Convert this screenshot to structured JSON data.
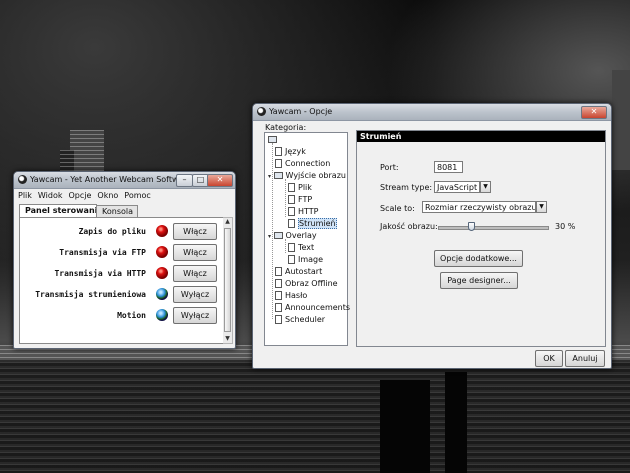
{
  "small_window": {
    "title": "Yawcam - Yet Another Webcam Software",
    "menu": [
      "Plik",
      "Widok",
      "Opcje",
      "Okno",
      "Pomoc"
    ],
    "tabs": [
      "Panel sterowania",
      "Konsola"
    ],
    "active_tab": "Panel sterowania",
    "rows": [
      {
        "label": "Zapis do pliku",
        "indicator": "red",
        "button": "Włącz"
      },
      {
        "label": "Transmisja via FTP",
        "indicator": "red",
        "button": "Włącz"
      },
      {
        "label": "Transmisja via HTTP",
        "indicator": "red",
        "button": "Włącz"
      },
      {
        "label": "Transmisja strumieniowa",
        "indicator": "globe",
        "button": "Wyłącz"
      },
      {
        "label": "Motion",
        "indicator": "globe",
        "button": "Wyłącz"
      }
    ]
  },
  "options_window": {
    "title": "Yawcam - Opcje",
    "category_label": "Kategoria:",
    "tree": [
      {
        "label": "Język",
        "type": "file"
      },
      {
        "label": "Connection",
        "type": "file"
      },
      {
        "label": "Wyjście obrazu",
        "type": "folder",
        "expanded": true
      },
      {
        "label": "Plik",
        "type": "file"
      },
      {
        "label": "FTP",
        "type": "file"
      },
      {
        "label": "HTTP",
        "type": "file"
      },
      {
        "label": "Strumień",
        "type": "file",
        "selected": true
      },
      {
        "label": "Overlay",
        "type": "folder",
        "expanded": true
      },
      {
        "label": "Text",
        "type": "file"
      },
      {
        "label": "Image",
        "type": "file"
      },
      {
        "label": "Autostart",
        "type": "file"
      },
      {
        "label": "Obraz Offline",
        "type": "file"
      },
      {
        "label": "Hasło",
        "type": "file"
      },
      {
        "label": "Announcements",
        "type": "file"
      },
      {
        "label": "Scheduler",
        "type": "file"
      }
    ],
    "panel": {
      "header": "Strumień",
      "port_label": "Port:",
      "port_value": "8081",
      "stream_type_label": "Stream type:",
      "stream_type_value": "JavaScript",
      "scale_label": "Scale to:",
      "scale_value": "Rozmiar rzeczywisty obrazu",
      "quality_label": "Jakość obrazu:",
      "quality_value_text": "30 %",
      "quality_fraction": 0.3,
      "more_options_button": "Opcje dodatkowe...",
      "page_designer_button": "Page designer..."
    },
    "ok_button": "OK",
    "cancel_button": "Anuluj"
  },
  "colors": {
    "selection": "#cfe3f8",
    "panel_header": "#000000",
    "close_button": "#c84530"
  }
}
